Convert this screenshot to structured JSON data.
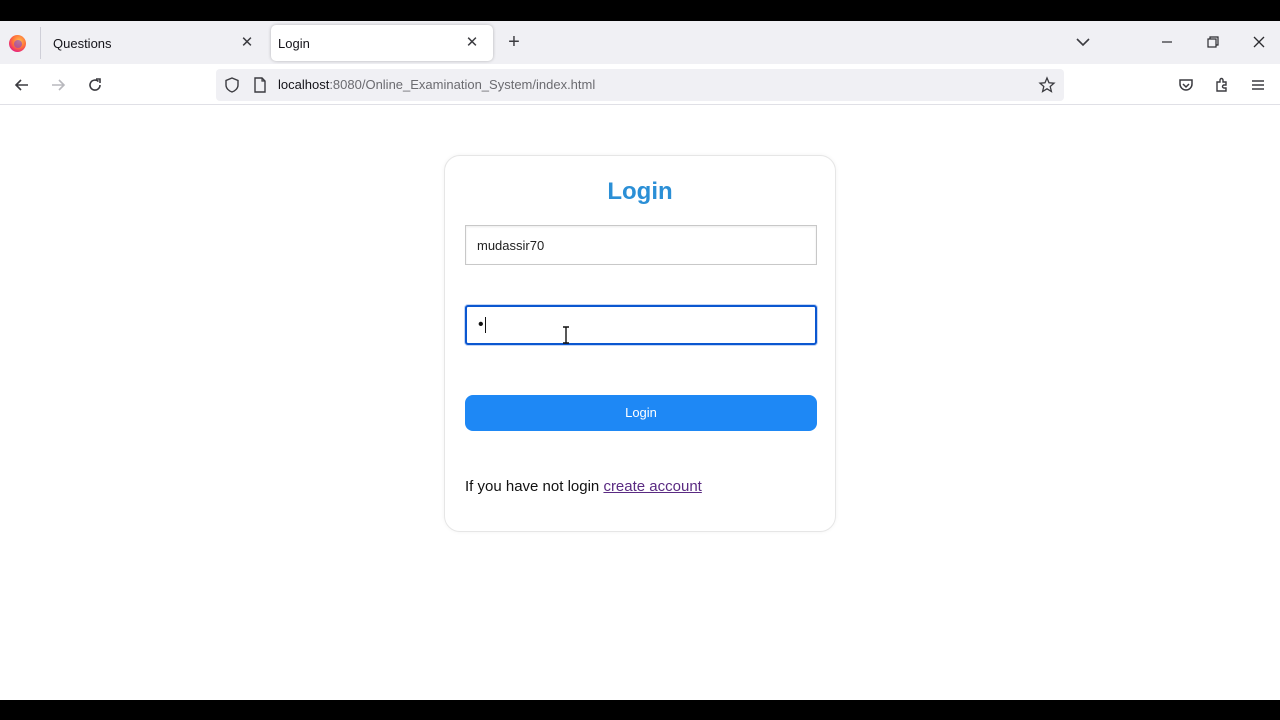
{
  "browser": {
    "tabs": [
      {
        "label": "Questions",
        "active": false
      },
      {
        "label": "Login",
        "active": true
      }
    ],
    "close_glyph": "✕",
    "new_tab_glyph": "+",
    "url": {
      "host": "localhost",
      "path": ":8080/Online_Examination_System/index.html"
    },
    "icons": [
      "firefox-logo",
      "back-icon",
      "forward-icon",
      "reload-icon",
      "shield-icon",
      "page-icon",
      "bookmark-star-icon",
      "pocket-icon",
      "extensions-icon",
      "menu-icon",
      "tab-list-icon",
      "minimize-icon",
      "restore-icon",
      "close-window-icon"
    ]
  },
  "login": {
    "title": "Login",
    "username_value": "mudassir70",
    "password_masked": "•",
    "button_label": "Login",
    "footer_prefix": "If you have not login ",
    "footer_link": "create account"
  },
  "colors": {
    "title": "#2b8fd6",
    "button": "#1e88f5",
    "link": "#5a2a82",
    "focus_border": "#0b57d0"
  }
}
